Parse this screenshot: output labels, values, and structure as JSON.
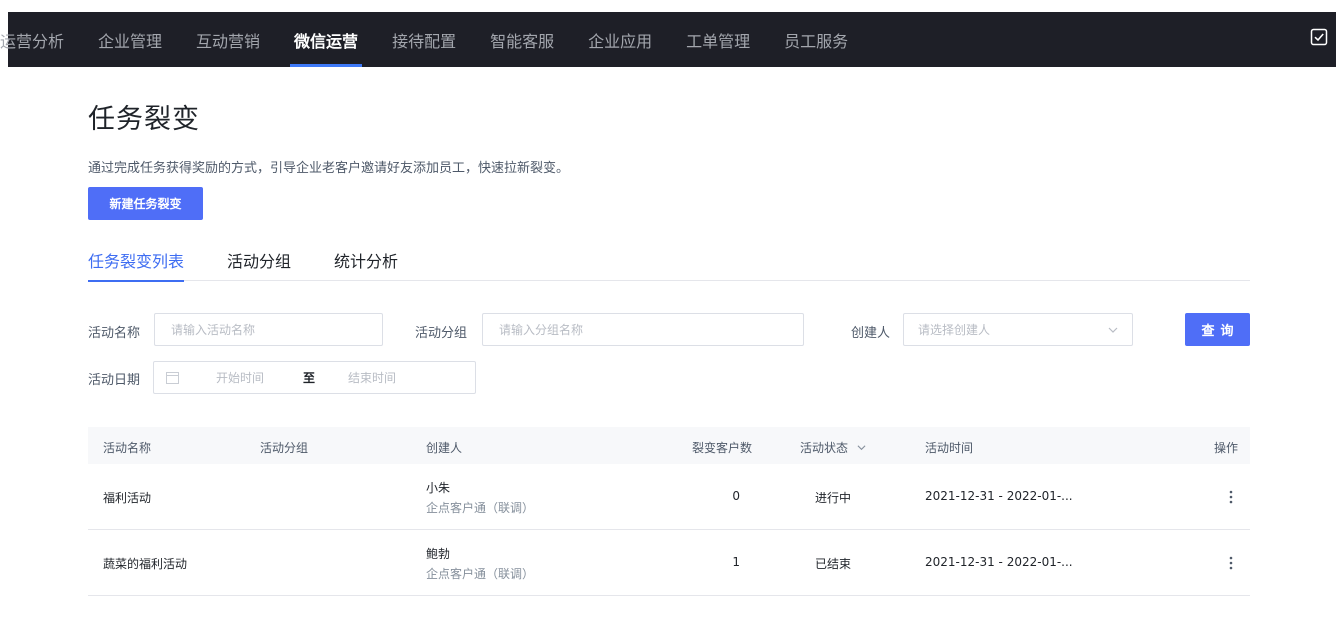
{
  "topnav": {
    "items": [
      {
        "label": "运营分析",
        "active": false
      },
      {
        "label": "企业管理",
        "active": false
      },
      {
        "label": "互动营销",
        "active": false
      },
      {
        "label": "微信运营",
        "active": true
      },
      {
        "label": "接待配置",
        "active": false
      },
      {
        "label": "智能客服",
        "active": false
      },
      {
        "label": "企业应用",
        "active": false
      },
      {
        "label": "工单管理",
        "active": false
      },
      {
        "label": "员工服务",
        "active": false
      }
    ],
    "right_icon": "checkbox-icon"
  },
  "page": {
    "title": "任务裂变",
    "description": "通过完成任务获得奖励的方式，引导企业老客户邀请好友添加员工，快速拉新裂变。",
    "new_button": "新建任务裂变"
  },
  "tabs": [
    {
      "label": "任务裂变列表",
      "active": true
    },
    {
      "label": "活动分组",
      "active": false
    },
    {
      "label": "统计分析",
      "active": false
    }
  ],
  "filters": {
    "name_label": "活动名称",
    "name_placeholder": "请输入活动名称",
    "group_label": "活动分组",
    "group_placeholder": "请输入分组名称",
    "creator_label": "创建人",
    "creator_placeholder": "请选择创建人",
    "query_button": "查询",
    "date_label": "活动日期",
    "date_start_placeholder": "开始时间",
    "date_separator": "至",
    "date_end_placeholder": "结束时间"
  },
  "table": {
    "columns": {
      "name": "活动名称",
      "group": "活动分组",
      "creator": "创建人",
      "count": "裂变客户数",
      "status": "活动状态",
      "time": "活动时间",
      "action": "操作"
    },
    "rows": [
      {
        "name": "福利活动",
        "group": "",
        "creator": "小朱",
        "creator_org": "企点客户通（联调）",
        "count": "0",
        "status": "进行中",
        "time": "2021-12-31 - 2022-01-..."
      },
      {
        "name": "蔬菜的福利活动",
        "group": "",
        "creator": "鲍勃",
        "creator_org": "企点客户通（联调）",
        "count": "1",
        "status": "已结束",
        "time": "2021-12-31 - 2022-01-..."
      }
    ]
  },
  "colors": {
    "nav_bg": "#1e1f27",
    "accent": "#4f6ef7",
    "tab_active": "#3e6df2"
  }
}
